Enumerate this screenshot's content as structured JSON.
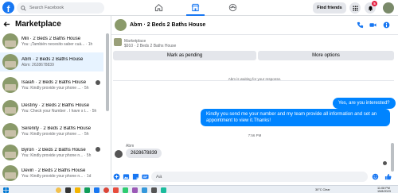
{
  "topbar": {
    "search_placeholder": "Search Facebook",
    "find_friends": "Find friends",
    "notifications_count": "5"
  },
  "marketplace": {
    "title": "Marketplace",
    "items": [
      {
        "name": "Mili · 2 Beds 2 Baths House",
        "preview": "You: ¡También necesito saber cuá... · 1h"
      },
      {
        "name": "Abm · 2 Beds 2 Baths House",
        "preview": "Abm: 2628678839"
      },
      {
        "name": "Isaiah · 2 Beds 2 Baths House",
        "preview": "You: Kindly provide your phone ... · 5h"
      },
      {
        "name": "Destiny · 2 Beds 2 Baths House",
        "preview": "You: Check your Number . I have s t... · 5h"
      },
      {
        "name": "Serenity · 2 Beds 2 Baths House",
        "preview": "You: Kindly provide your phone ... · 5h"
      },
      {
        "name": "Byron · 2 Beds 2 Baths House",
        "preview": "You: Kindly provide your phone n... · 5h"
      },
      {
        "name": "Devin · 2 Beds 2 Baths House",
        "preview": "You: Kindly provide your phone n... · 1d"
      }
    ]
  },
  "chat": {
    "title": "Abm · 2 Beds 2 Baths House",
    "listing_label": "Marketplace",
    "listing_detail": "$910 · 2 Beds 2 Baths House",
    "mark_pending": "Mark as pending",
    "more_options": "More options",
    "waiting_note": "Abm is waiting for your response.",
    "time1": "4:38 PM",
    "msg_out_1": "Yes, are you interested?",
    "msg_out_2": "Kindly you send me your number and my team provide all information and set an appointment to view it.Thanks!",
    "time2": "7:56 PM",
    "sender": "Abm",
    "msg_in_1": "2628678839",
    "composer_placeholder": "Aa"
  },
  "taskbar": {
    "weather": "30°C Clear",
    "time": "11:08 PM",
    "date": "15/8/2023"
  },
  "colors": {
    "accent": "#1877f2",
    "bubble_out": "#0084ff",
    "badge": "#e41e3f"
  }
}
